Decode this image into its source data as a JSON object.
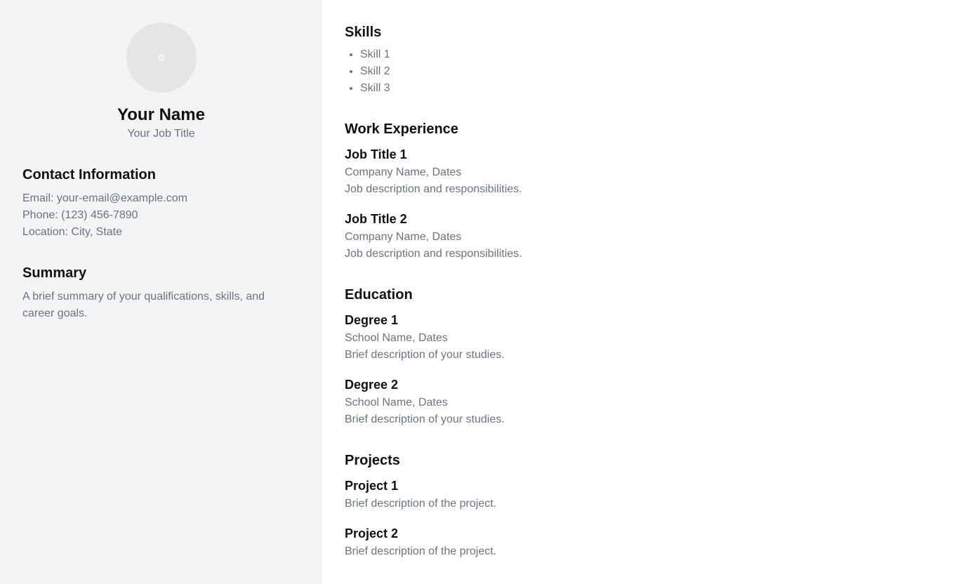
{
  "profile": {
    "name": "Your Name",
    "job_title": "Your Job Title",
    "avatar_icon": "avatar-placeholder-icon"
  },
  "contact": {
    "heading": "Contact Information",
    "email": "Email: your-email@example.com",
    "phone": "Phone: (123) 456-7890",
    "location": "Location: City, State"
  },
  "summary": {
    "heading": "Summary",
    "text": "A brief summary of your qualifications, skills, and career goals."
  },
  "skills": {
    "heading": "Skills",
    "items": [
      "Skill 1",
      "Skill 2",
      "Skill 3"
    ]
  },
  "work": {
    "heading": "Work Experience",
    "entries": [
      {
        "title": "Job Title 1",
        "meta": "Company Name, Dates",
        "desc": "Job description and responsibilities."
      },
      {
        "title": "Job Title 2",
        "meta": "Company Name, Dates",
        "desc": "Job description and responsibilities."
      }
    ]
  },
  "education": {
    "heading": "Education",
    "entries": [
      {
        "title": "Degree 1",
        "meta": "School Name, Dates",
        "desc": "Brief description of your studies."
      },
      {
        "title": "Degree 2",
        "meta": "School Name, Dates",
        "desc": "Brief description of your studies."
      }
    ]
  },
  "projects": {
    "heading": "Projects",
    "entries": [
      {
        "title": "Project 1",
        "desc": "Brief description of the project."
      },
      {
        "title": "Project 2",
        "desc": "Brief description of the project."
      }
    ]
  },
  "colors": {
    "sidebar_bg": "#f3f4f6",
    "muted_text": "#6b7280",
    "heading_text": "#111111"
  }
}
